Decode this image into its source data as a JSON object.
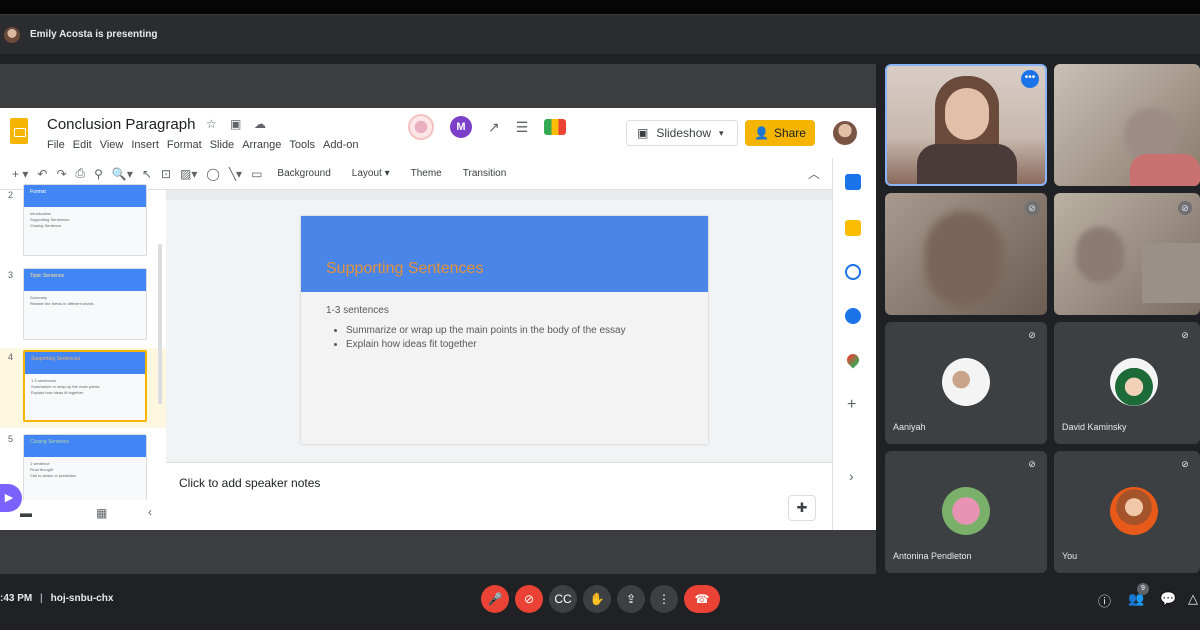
{
  "presenter": {
    "banner": "Emily Acosta is presenting"
  },
  "slides_app": {
    "doc_title": "Conclusion Paragraph",
    "menu": [
      "File",
      "Edit",
      "View",
      "Insert",
      "Format",
      "Slide",
      "Arrange",
      "Tools",
      "Add-on"
    ],
    "slideshow_label": "Slideshow",
    "share_label": "Share",
    "toolbar_text": {
      "background": "Background",
      "layout": "Layout",
      "theme": "Theme",
      "transition": "Transition"
    },
    "thumbnails": [
      {
        "num": "2",
        "title": "Format",
        "lines": [
          "Introduction",
          "Supporting Sentences",
          "Closing Sentence"
        ]
      },
      {
        "num": "3",
        "title": "Topic Sentence",
        "lines": [
          "Summary",
          "Restate the thesis in different words"
        ]
      },
      {
        "num": "4",
        "title": "Supporting Sentences",
        "lines": [
          "1-3 sentences",
          "Summarize or wrap up the main points",
          "Explain how ideas fit together"
        ]
      },
      {
        "num": "5",
        "title": "Closing Sentence",
        "lines": [
          "1 sentence",
          "Final thought",
          "Call to action or prediction"
        ]
      }
    ],
    "current_slide": {
      "title": "Supporting Sentences",
      "subtitle": "1-3 sentences",
      "bullets": [
        "Summarize or wrap up the main points in the body of the essay",
        "Explain how ideas fit together"
      ]
    },
    "speaker_notes_placeholder": "Click to add speaker notes"
  },
  "participants": [
    {
      "id": "presenter",
      "name": "",
      "active": true
    },
    {
      "id": "p2",
      "name": ""
    },
    {
      "id": "p3",
      "name": ""
    },
    {
      "id": "p4",
      "name": ""
    },
    {
      "id": "p5",
      "name": "Aaniyah"
    },
    {
      "id": "p6",
      "name": "David Kaminsky"
    },
    {
      "id": "p7",
      "name": "Antonina Pendleton"
    },
    {
      "id": "p8",
      "name": "You"
    }
  ],
  "meeting": {
    "time": ":43 PM",
    "code": "hoj-snbu-chx",
    "participant_count": "9"
  },
  "colors": {
    "accent_blue": "#4a86e8",
    "slide_title": "#e69138",
    "share_yellow": "#f4b400",
    "end_red": "#ea4335"
  }
}
